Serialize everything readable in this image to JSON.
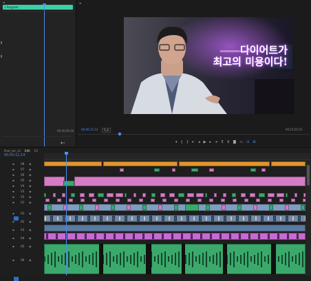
{
  "source": {
    "clip_label": "1 Program",
    "timecode": "00;00;00;00"
  },
  "program": {
    "timecode": "00;00;11;14",
    "fit_label": "Full",
    "end_timecode": "00;15;05;01",
    "subtitle_line1": "다이어트가",
    "subtitle_line2": "최고의 미용이다!"
  },
  "timeline": {
    "tabs": [
      "final_ver_v2",
      "Edit",
      "V2"
    ],
    "timecode": "00;00;11;14",
    "tracks": [
      "V8",
      "V7",
      "V6",
      "V5",
      "V4",
      "V3",
      "V2",
      "V1",
      "A1",
      "A2",
      "A3",
      "A4",
      "A5",
      "A6"
    ]
  },
  "colors": {
    "teal": "#3bd0a5",
    "playhead": "#4d8df0",
    "orange": "#e2952c",
    "pink": "#d57cc6",
    "blue_clip": "#7f9dc0",
    "green_clip": "#3aa96b",
    "magenta": "#c86ad4"
  }
}
